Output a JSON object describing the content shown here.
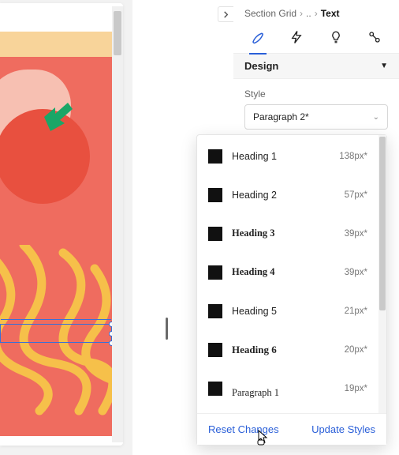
{
  "breadcrumb": {
    "root": "Section Grid",
    "ellipsis": "..",
    "leaf": "Text"
  },
  "tabs": {
    "design_id": "design-tab",
    "animate_id": "animate-tab",
    "ideas_id": "ideas-tab",
    "code_id": "code-tab"
  },
  "section": {
    "title": "Design",
    "caret": "▼"
  },
  "style_field": {
    "label": "Style",
    "selected": "Paragraph 2*"
  },
  "styles": [
    {
      "name": "Heading 1",
      "size": "138px*",
      "font_class": "f-h1"
    },
    {
      "name": "Heading 2",
      "size": "57px*",
      "font_class": "f-h2"
    },
    {
      "name": "Heading 3",
      "size": "39px*",
      "font_class": "f-h3"
    },
    {
      "name": "Heading 4",
      "size": "39px*",
      "font_class": "f-h4"
    },
    {
      "name": "Heading 5",
      "size": "21px*",
      "font_class": "f-h5"
    },
    {
      "name": "Heading 6",
      "size": "20px*",
      "font_class": "f-h6"
    },
    {
      "name": "Paragraph 1",
      "size": "19px*",
      "font_class": "f-p1"
    }
  ],
  "popover": {
    "reset": "Reset Changes",
    "update": "Update Styles"
  },
  "colors": {
    "accent": "#2a5fd8",
    "canvas_bg": "#f8d49a",
    "canvas_red": "#ef6c5f"
  }
}
